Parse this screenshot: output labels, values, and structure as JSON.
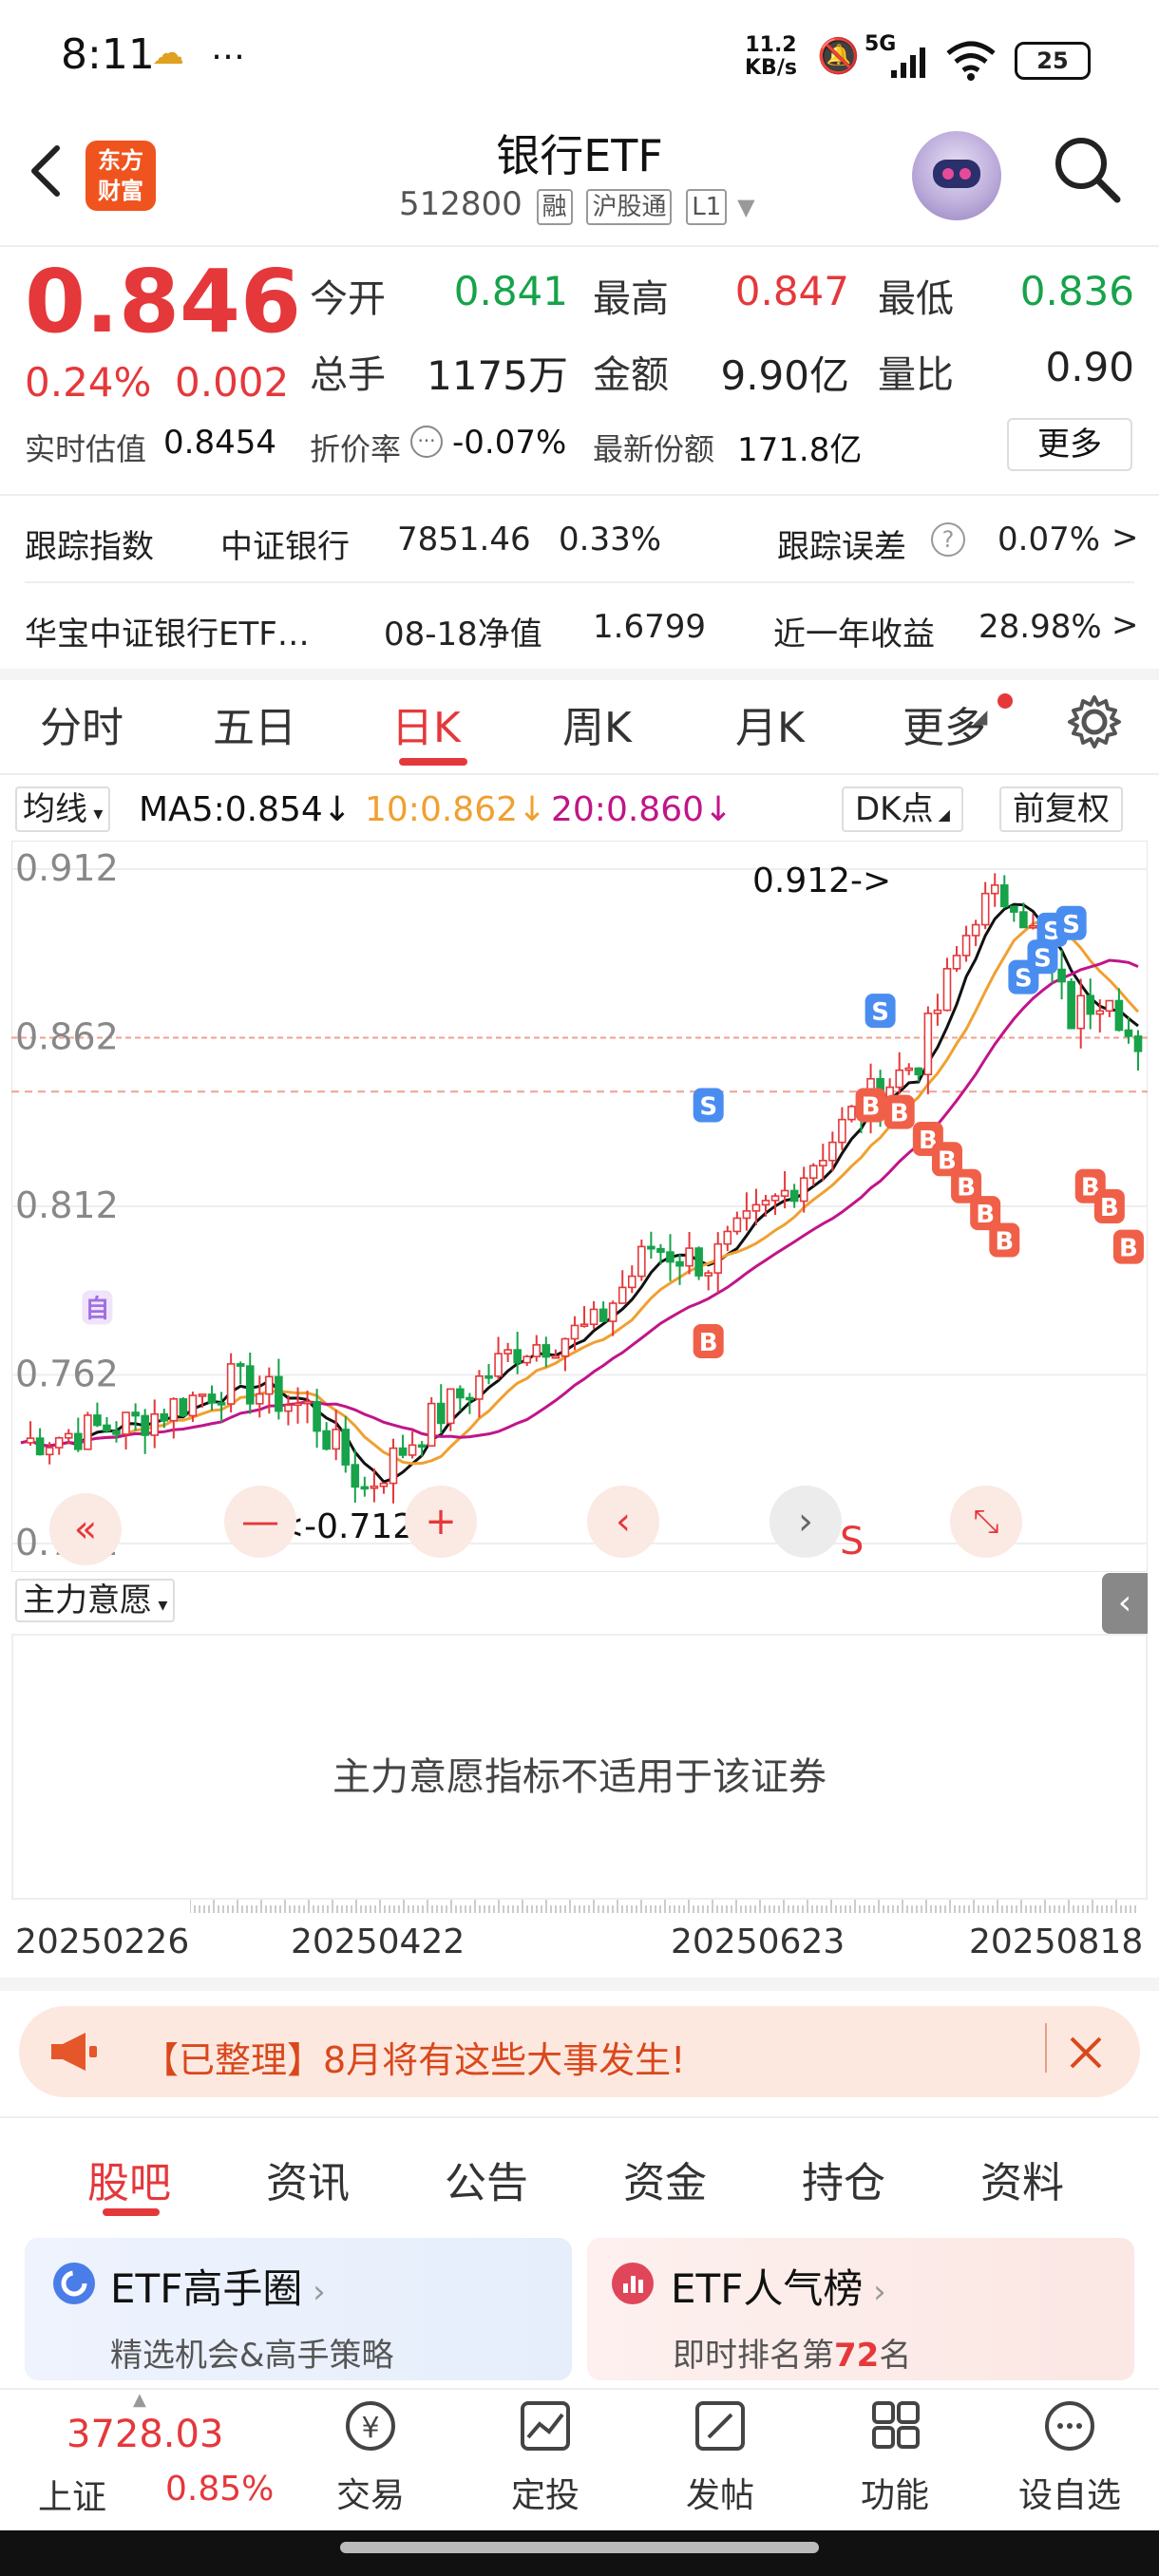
{
  "status_bar": {
    "time": "8:11",
    "extra_icons": "…",
    "net_speed_value": "11.2",
    "net_speed_unit": "KB/s",
    "signal": "5G",
    "battery": "25"
  },
  "header": {
    "logo_text_1": "东方",
    "logo_text_2": "财富",
    "title": "银行ETF",
    "code": "512800",
    "tags": [
      "融",
      "沪股通",
      "L1"
    ]
  },
  "quote": {
    "price": "0.846",
    "change_pct": "0.24%",
    "change": "0.002",
    "open_label": "今开",
    "open": "0.841",
    "high_label": "最高",
    "high": "0.847",
    "low_label": "最低",
    "low": "0.836",
    "volume_label": "总手",
    "volume": "1175万",
    "amount_label": "金额",
    "amount": "9.90亿",
    "vol_ratio_label": "量比",
    "vol_ratio": "0.90",
    "est_label": "实时估值",
    "est": "0.8454",
    "discount_label": "折价率",
    "discount": "-0.07%",
    "shares_label": "最新份额",
    "shares": "171.8亿",
    "more": "更多"
  },
  "tracking": {
    "index_label": "跟踪指数",
    "index_name": "中证银行",
    "index_value": "7851.46",
    "index_pct": "0.33%",
    "error_label": "跟踪误差",
    "error_value": "0.07%"
  },
  "fund": {
    "name": "华宝中证银行ETF…",
    "nav_label": "08-18净值",
    "nav": "1.6799",
    "return_label": "近一年收益",
    "return_value": "28.98%"
  },
  "chart_tabs": [
    "分时",
    "五日",
    "日K",
    "周K",
    "月K",
    "更多"
  ],
  "ma_row": {
    "selector": "均线",
    "ma5": "MA5:0.854",
    "ma10": "10:0.862",
    "ma20": "20:0.860",
    "dk": "DK点",
    "adjust": "前复权"
  },
  "chart_data": {
    "type": "candlestick",
    "y_ticks": [
      "0.912",
      "0.862",
      "0.812",
      "0.762",
      "0.712"
    ],
    "ylim": [
      0.712,
      0.912
    ],
    "max_annotation": "0.912->",
    "min_annotation": "<-0.712",
    "x_ticks": [
      "20250226",
      "20250422",
      "20250623",
      "20250818"
    ],
    "series": [
      {
        "name": "MA5",
        "color": "#111111"
      },
      {
        "name": "MA10",
        "color": "#f0a030"
      },
      {
        "name": "MA20",
        "color": "#c0158a"
      }
    ],
    "signal_marker_labels": [
      "S",
      "B",
      "自"
    ],
    "s_marker": "S"
  },
  "sub_indicator": {
    "selector": "主力意愿",
    "notice": "主力意愿指标不适用于该证券"
  },
  "banner": {
    "text": "【已整理】8月将有这些大事发生!"
  },
  "bottom_tabs": [
    "股吧",
    "资讯",
    "公告",
    "资金",
    "持仓",
    "资料"
  ],
  "cards": [
    {
      "title": "ETF高手圈",
      "sub": "精选机会&高手策略"
    },
    {
      "title": "ETF人气榜",
      "sub_prefix": "即时排名第",
      "sub_rank": "72",
      "sub_suffix": "名"
    }
  ],
  "bottom_nav": {
    "index_value": "3728.03",
    "index_name": "上证",
    "index_pct": "0.85%",
    "items": [
      "交易",
      "定投",
      "发帖",
      "功能",
      "设自选"
    ]
  },
  "colors": {
    "up": "#e5383b",
    "down": "#16a34a",
    "accent": "#f0541e"
  }
}
